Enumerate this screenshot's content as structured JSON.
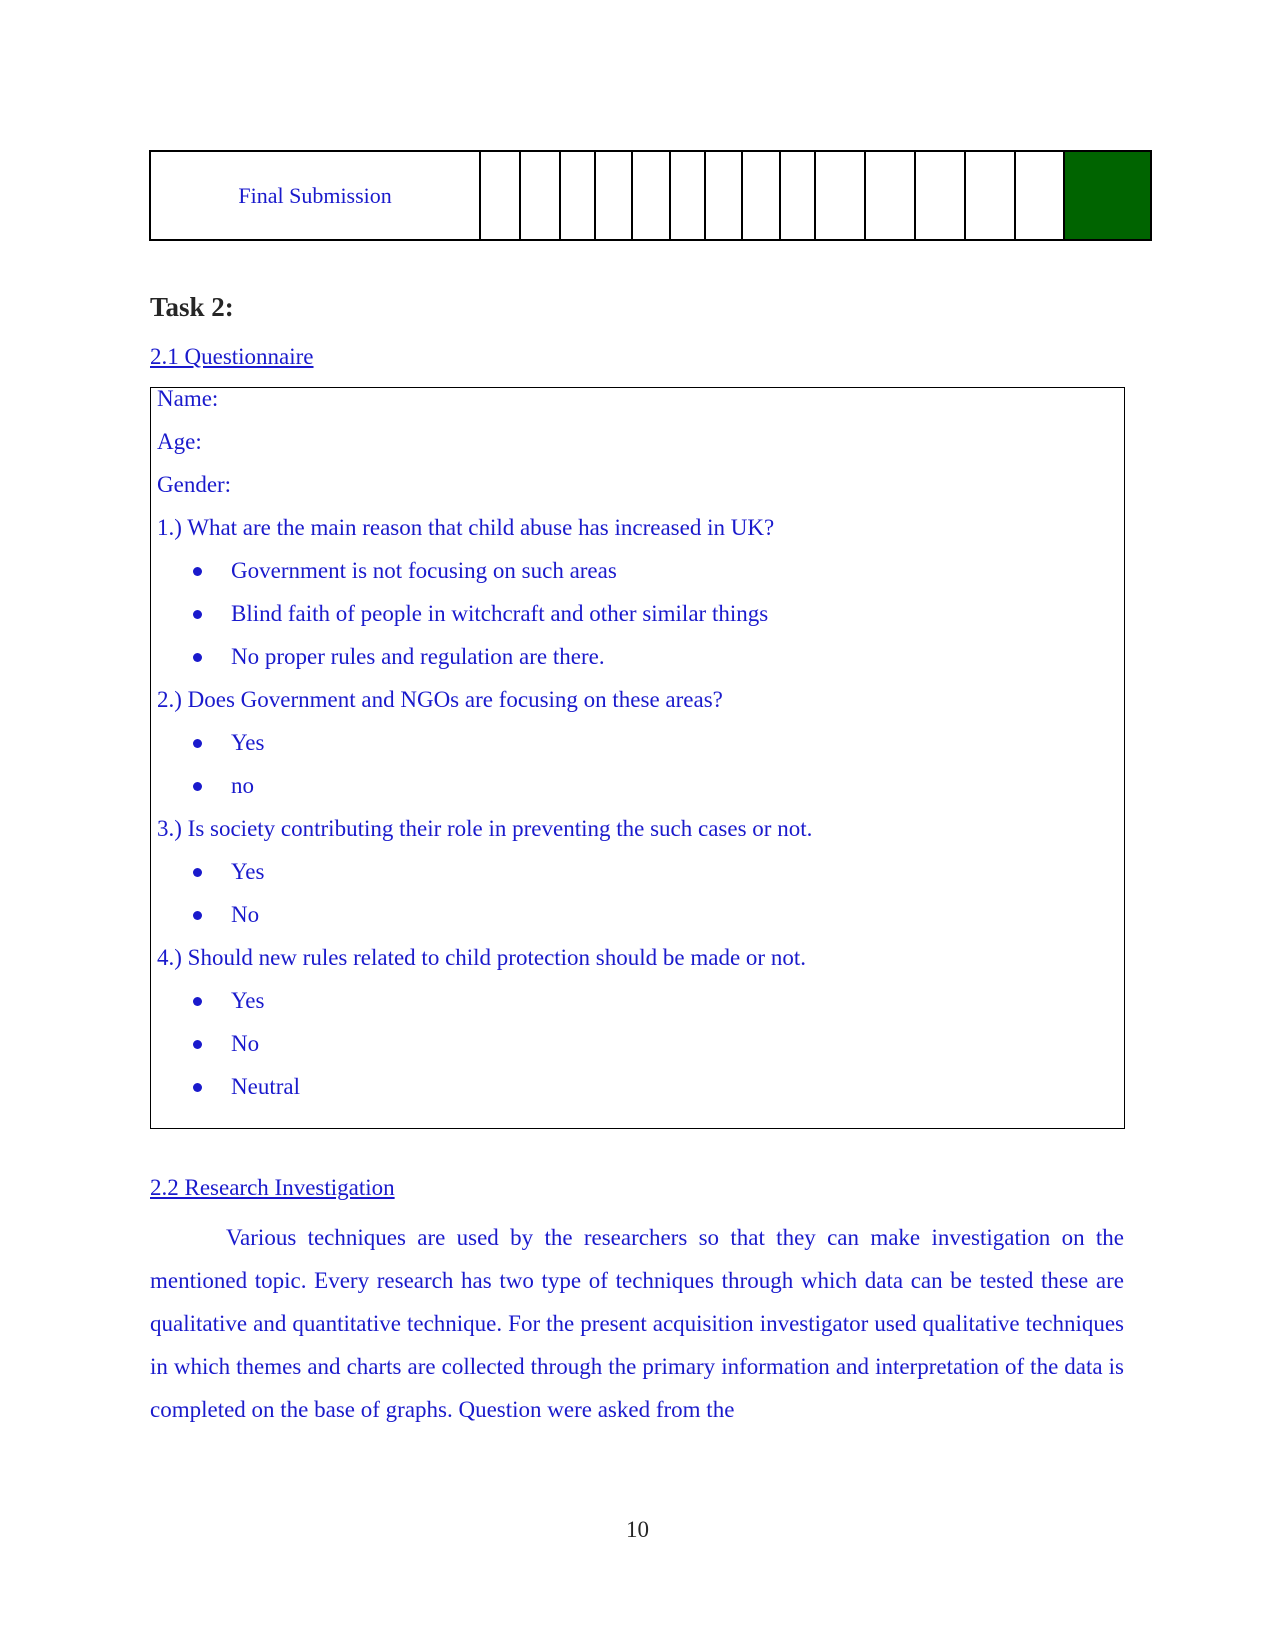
{
  "gantt_row": {
    "task_label": "Final Submission",
    "period_count": 16,
    "filled_periods": [
      16
    ],
    "fill_color": "#006400"
  },
  "task_heading": "Task 2:",
  "questionnaire": {
    "section_title": "2.1 Questionnaire",
    "fields": [
      "Name:",
      "Age:",
      "Gender:"
    ],
    "questions": [
      {
        "text": "1.) What are the main reason that child abuse has increased in UK?",
        "options": [
          "Government is not focusing on such areas",
          "Blind faith of people in witchcraft and other similar things",
          "No proper rules and regulation are there."
        ]
      },
      {
        "text": "2.) Does Government and NGOs are focusing on these areas?",
        "options": [
          "Yes",
          "no"
        ]
      },
      {
        "text": "3.) Is society contributing their role in preventing the such cases or not.",
        "options": [
          "Yes",
          "No"
        ]
      },
      {
        "text": "4.) Should new rules related to child protection should be made or not.",
        "options": [
          "Yes",
          "No",
          "Neutral"
        ]
      }
    ]
  },
  "research": {
    "section_title": "2.2 Research Investigation",
    "paragraph": "Various techniques are used by the researchers so that they can make investigation on the mentioned topic. Every research has two type of techniques through which data can be tested these are qualitative and quantitative technique. For the present acquisition investigator used qualitative techniques in which themes and charts are collected through the primary information and interpretation of the data is completed on the base of graphs. Question were asked from the"
  },
  "page_number": "10"
}
